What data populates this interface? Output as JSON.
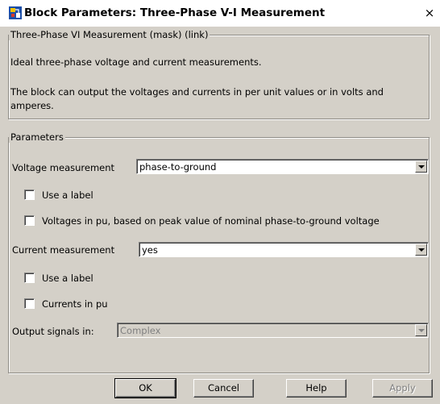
{
  "window": {
    "title": "Block Parameters: Three-Phase V-I Measurement",
    "close": "×",
    "icon": "simulink-block-icon"
  },
  "description": {
    "legend": "Three-Phase VI Measurement (mask) (link)",
    "line1": "Ideal three-phase voltage and current measurements.",
    "line2": "The block can output the voltages and currents in per unit values or in volts and",
    "line3": "amperes."
  },
  "parameters": {
    "legend": "Parameters",
    "voltage_measurement": {
      "label": "Voltage measurement",
      "value": "phase-to-ground"
    },
    "use_label_1": {
      "label": "Use a label",
      "checked": false
    },
    "voltages_pu": {
      "label": "Voltages in pu,  based on peak value of nominal phase-to-ground voltage",
      "checked": false
    },
    "current_measurement": {
      "label": "Current measurement",
      "value": "yes"
    },
    "use_label_2": {
      "label": "Use a label",
      "checked": false
    },
    "currents_pu": {
      "label": "Currents in pu",
      "checked": false
    },
    "output_signals": {
      "label": "Output signals in:",
      "value": "Complex",
      "enabled": false
    }
  },
  "buttons": {
    "ok": "OK",
    "cancel": "Cancel",
    "help": "Help",
    "apply": "Apply"
  }
}
